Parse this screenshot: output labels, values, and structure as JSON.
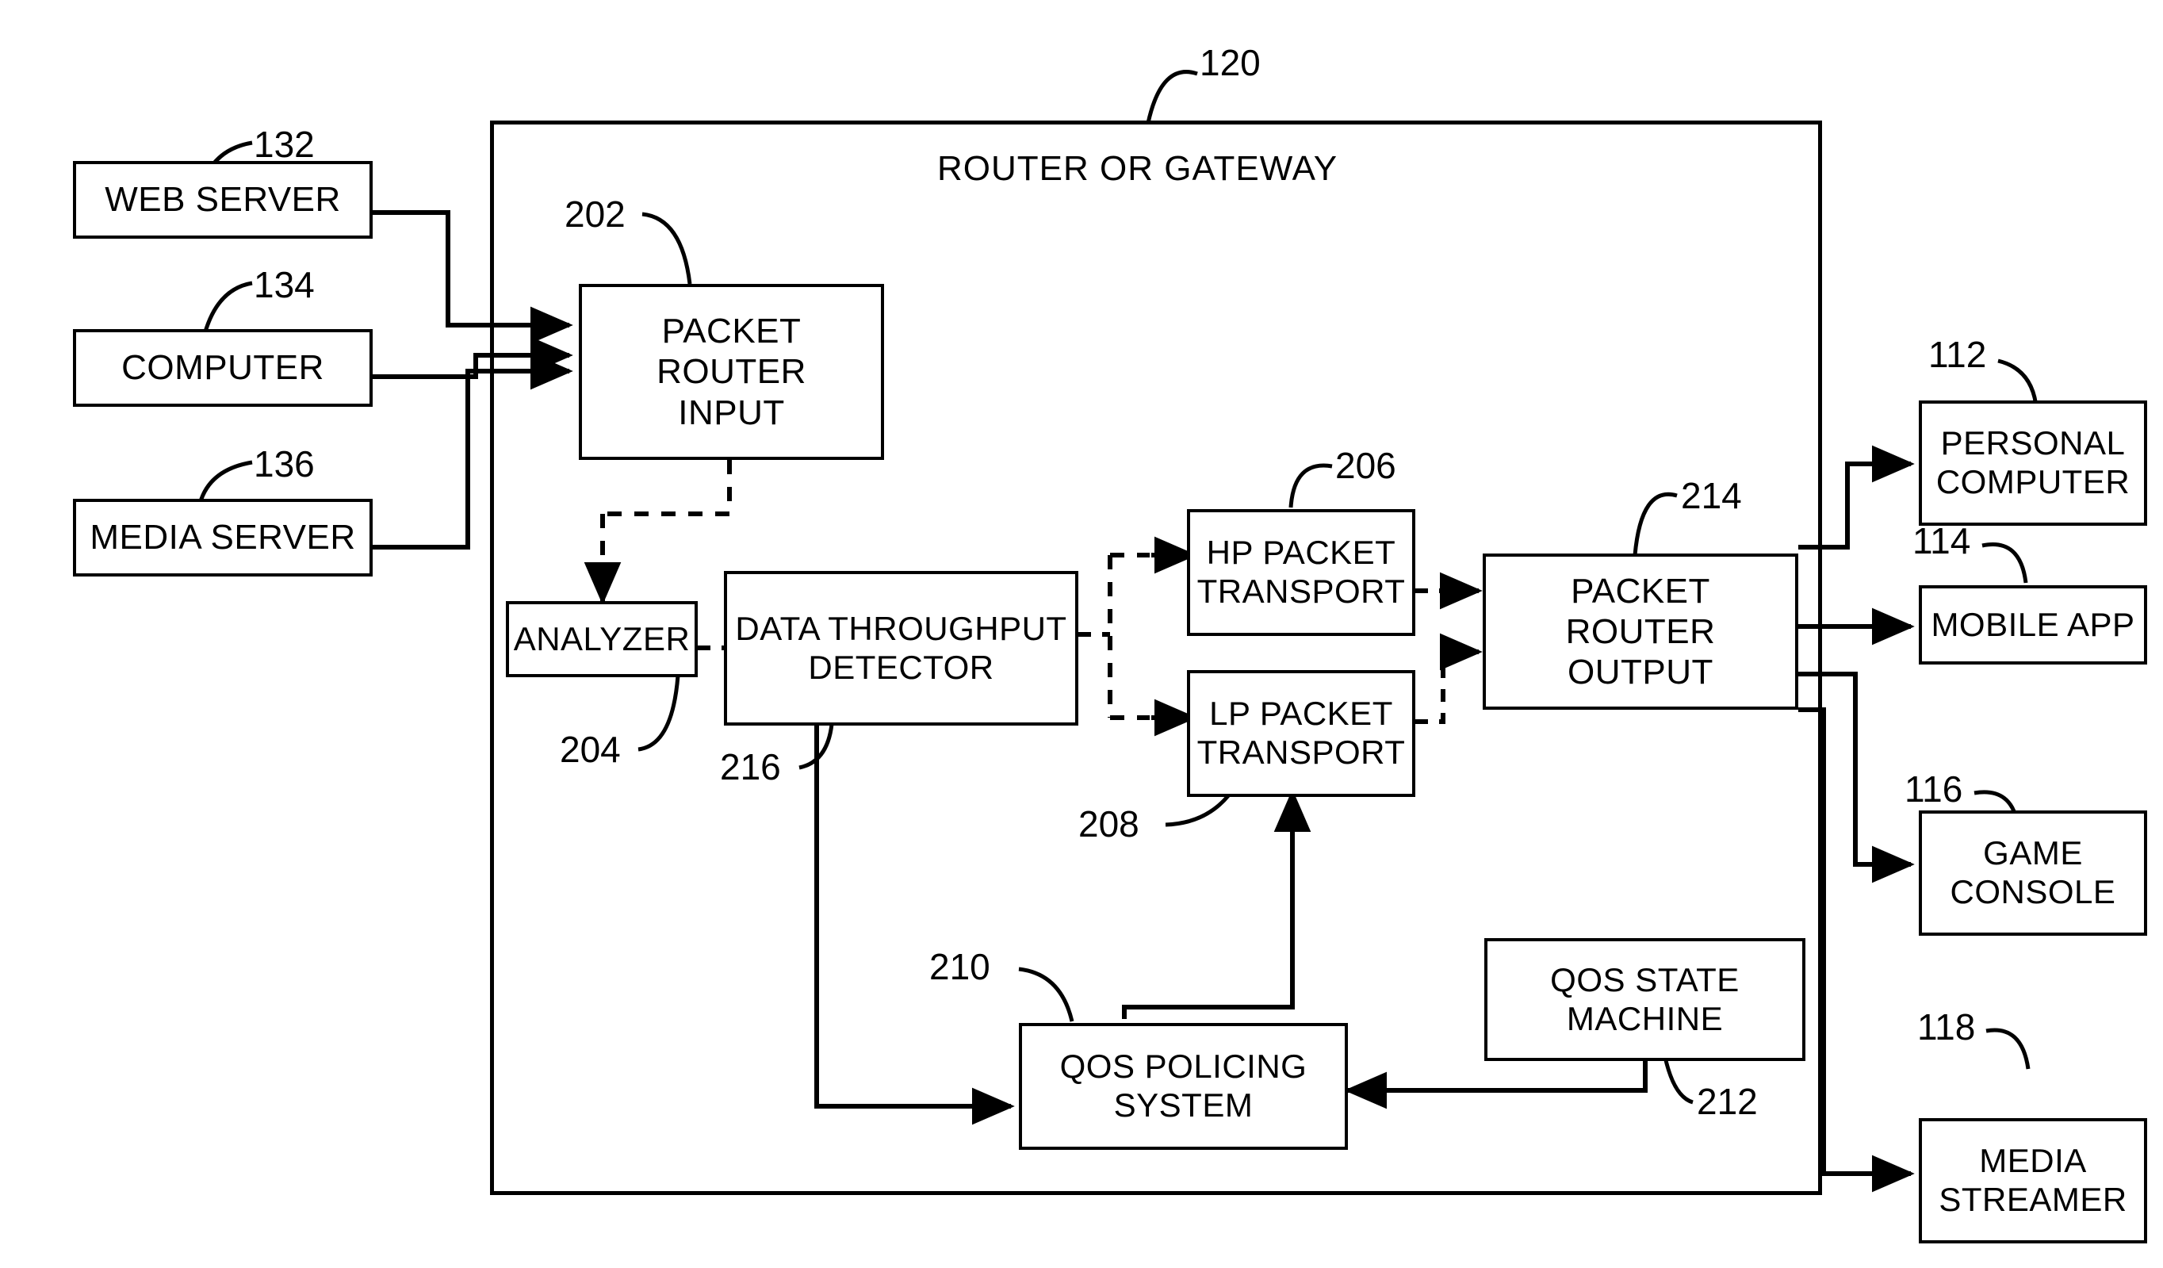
{
  "figure": {
    "type": "patent-block-diagram",
    "title": "ROUTER OR GATEWAY",
    "container_ref": "120"
  },
  "outer_container": {
    "label": "ROUTER OR GATEWAY",
    "ref": "120"
  },
  "nodes": {
    "web_server": {
      "label": "WEB SERVER",
      "ref": "132"
    },
    "computer": {
      "label": "COMPUTER",
      "ref": "134"
    },
    "media_server": {
      "label": "MEDIA SERVER",
      "ref": "136"
    },
    "packet_router_input": {
      "line1": "PACKET ROUTER",
      "line2": "INPUT",
      "ref": "202"
    },
    "analyzer": {
      "label": "ANALYZER",
      "ref": "204"
    },
    "data_throughput_detector": {
      "line1": "DATA THROUGHPUT",
      "line2": "DETECTOR",
      "ref": "216"
    },
    "hp_packet_transport": {
      "line1": "HP PACKET",
      "line2": "TRANSPORT",
      "ref": "206"
    },
    "lp_packet_transport": {
      "line1": "LP PACKET",
      "line2": "TRANSPORT",
      "ref": "208"
    },
    "packet_router_output": {
      "line1": "PACKET ROUTER",
      "line2": "OUTPUT",
      "ref": "214"
    },
    "qos_policing_system": {
      "line1": "QOS POLICING",
      "line2": "SYSTEM",
      "ref": "210"
    },
    "qos_state_machine": {
      "line1": "QOS STATE",
      "line2": "MACHINE",
      "ref": "212"
    },
    "personal_computer": {
      "line1": "PERSONAL",
      "line2": "COMPUTER",
      "ref": "112"
    },
    "mobile_app": {
      "label": "MOBILE APP",
      "ref": "114"
    },
    "game_console": {
      "line1": "GAME",
      "line2": "CONSOLE",
      "ref": "116"
    },
    "media_streamer": {
      "line1": "MEDIA",
      "line2": "STREAMER",
      "ref": "118"
    }
  },
  "reference_numerals": {
    "n112": "112",
    "n114": "114",
    "n116": "116",
    "n118": "118",
    "n120": "120",
    "n132": "132",
    "n134": "134",
    "n136": "136",
    "n202": "202",
    "n204": "204",
    "n206": "206",
    "n208": "208",
    "n210": "210",
    "n212": "212",
    "n214": "214",
    "n216": "216"
  },
  "colors": {
    "line": "#000000",
    "background": "#ffffff"
  }
}
